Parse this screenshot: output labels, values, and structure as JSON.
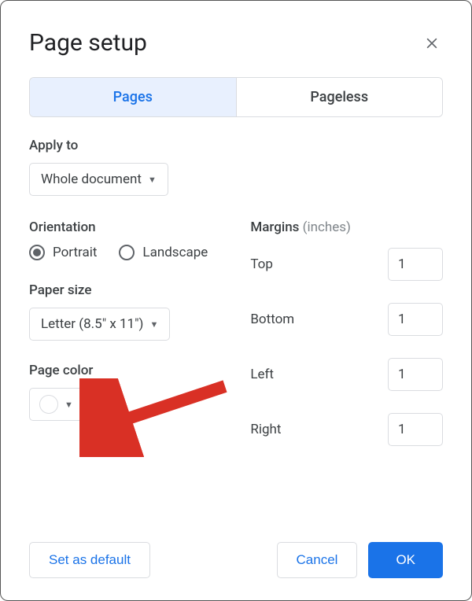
{
  "title": "Page setup",
  "tabs": {
    "pages": "Pages",
    "pageless": "Pageless"
  },
  "applyTo": {
    "label": "Apply to",
    "value": "Whole document"
  },
  "orientation": {
    "label": "Orientation",
    "portrait": "Portrait",
    "landscape": "Landscape",
    "selected": "portrait"
  },
  "paperSize": {
    "label": "Paper size",
    "value": "Letter (8.5\" x 11\")"
  },
  "pageColor": {
    "label": "Page color",
    "value": "#ffffff"
  },
  "margins": {
    "label": "Margins ",
    "unitsHint": "(inches)",
    "top": {
      "name": "Top",
      "value": "1"
    },
    "bottom": {
      "name": "Bottom",
      "value": "1"
    },
    "left": {
      "name": "Left",
      "value": "1"
    },
    "right": {
      "name": "Right",
      "value": "1"
    }
  },
  "buttons": {
    "setDefault": "Set as default",
    "cancel": "Cancel",
    "ok": "OK"
  }
}
